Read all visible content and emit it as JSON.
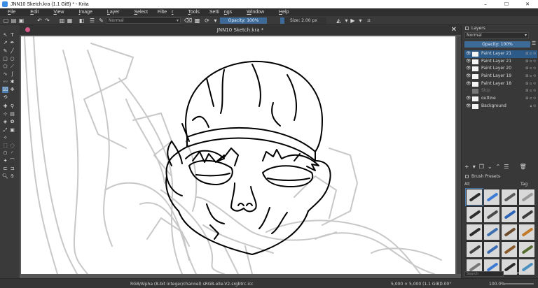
{
  "window": {
    "title": "JNN10 Sketch.kra (1.1 GiB)  * - Krita",
    "controls": [
      "–",
      "☐",
      "✕"
    ]
  },
  "menu": [
    {
      "pre": "",
      "u": "F",
      "post": "ile"
    },
    {
      "pre": "",
      "u": "E",
      "post": "dit"
    },
    {
      "pre": "",
      "u": "V",
      "post": "iew"
    },
    {
      "pre": "",
      "u": "I",
      "post": "mage"
    },
    {
      "pre": "",
      "u": "L",
      "post": "ayer"
    },
    {
      "pre": "",
      "u": "S",
      "post": "elect"
    },
    {
      "pre": "Filte",
      "u": "r",
      "post": ""
    },
    {
      "pre": "",
      "u": "T",
      "post": "ools"
    },
    {
      "pre": "Setti",
      "u": "n",
      "post": "gs"
    },
    {
      "pre": "",
      "u": "W",
      "post": "indow"
    },
    {
      "pre": "",
      "u": "H",
      "post": "elp"
    }
  ],
  "tool_options": {
    "blend_mode": "Normal",
    "opacity": "Opacity: 100%",
    "size": "Size: 2.00 px"
  },
  "document": {
    "tab_title": "JNN10 Sketch.kra *",
    "close": "✕"
  },
  "layers_docker": {
    "title": "Layers",
    "blend_mode": "Normal",
    "opacity": "Opacity:  100%",
    "layers": [
      {
        "name": "Paint Layer 21",
        "selected": true,
        "visible": true,
        "locked": false
      },
      {
        "name": "Paint Layer 21",
        "selected": false,
        "visible": true,
        "locked": false
      },
      {
        "name": "Paint Layer 20",
        "selected": false,
        "visible": true,
        "locked": false
      },
      {
        "name": "Paint Layer 19",
        "selected": false,
        "visible": true,
        "locked": false
      },
      {
        "name": "Paint Layer 18",
        "selected": false,
        "visible": true,
        "locked": false
      },
      {
        "name": "Skip",
        "selected": false,
        "visible": false,
        "locked": false
      },
      {
        "name": "outline",
        "selected": false,
        "visible": true,
        "locked": false
      },
      {
        "name": "Background",
        "selected": false,
        "visible": true,
        "locked": true
      }
    ]
  },
  "brush_docker": {
    "title": "Brush Presets",
    "filter_all": "All",
    "tag_label": "Tag",
    "search_placeholder": "Search",
    "filter_in_tag": "Filter in Tag",
    "presets": [
      "#2c2c2c",
      "#3d7ad6",
      "#5a5a5a",
      "#999999",
      "#2c2c2c",
      "#4a4a4a",
      "#2b63b8",
      "#3a3a3a",
      "#2c2c2c",
      "#3e6fae",
      "#6b4b2b",
      "#c07a2a",
      "#444444",
      "#3b6bb2",
      "#8a5a2a",
      "#556b2f",
      "#777777",
      "#3d7ad6",
      "#2c2c2c",
      "#4a90c0"
    ]
  },
  "status": {
    "colorspace": "RGB/Alpha (8-bit integer/channel)  sRGB-elle-V2-srgbtrc.icc",
    "dimensions": "5,000 × 5,000 (1.1 GiB)",
    "rotation": "0.00°",
    "zoom": "100.0%"
  }
}
